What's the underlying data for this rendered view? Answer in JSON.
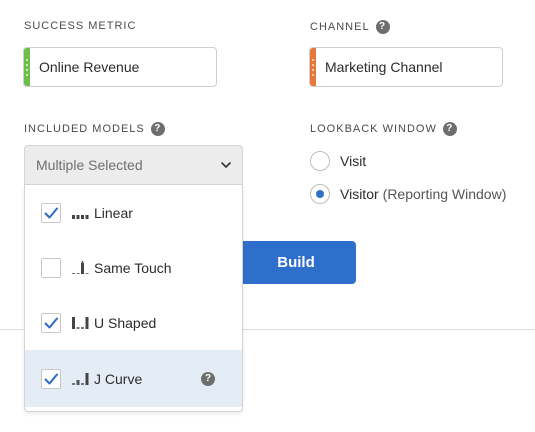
{
  "success_metric": {
    "label": "SUCCESS METRIC",
    "value": "Online Revenue",
    "stripe_color": "#6cbf4a"
  },
  "channel": {
    "label": "CHANNEL",
    "value": "Marketing Channel",
    "stripe_color": "#e8773a",
    "help_icon": "?"
  },
  "included_models": {
    "label": "INCLUDED MODELS",
    "help_icon": "?",
    "dropdown_value": "Multiple Selected",
    "options": [
      {
        "label": "Linear",
        "checked": true,
        "icon": "linear-model-icon"
      },
      {
        "label": "Same Touch",
        "checked": false,
        "icon": "same-touch-model-icon"
      },
      {
        "label": "U Shaped",
        "checked": true,
        "icon": "u-shaped-model-icon"
      },
      {
        "label": "J Curve",
        "checked": true,
        "icon": "j-curve-model-icon",
        "help_icon": "?"
      }
    ]
  },
  "lookback_window": {
    "label": "LOOKBACK WINDOW",
    "help_icon": "?",
    "options": [
      {
        "label": "Visit",
        "sublabel": "",
        "selected": false
      },
      {
        "label": "Visitor",
        "sublabel": "(Reporting Window)",
        "selected": true
      }
    ]
  },
  "build_button": {
    "label": "Build"
  },
  "colors": {
    "accent": "#2e6fcb",
    "check": "#2d6bc4",
    "hover_row": "#e4ecf6"
  }
}
